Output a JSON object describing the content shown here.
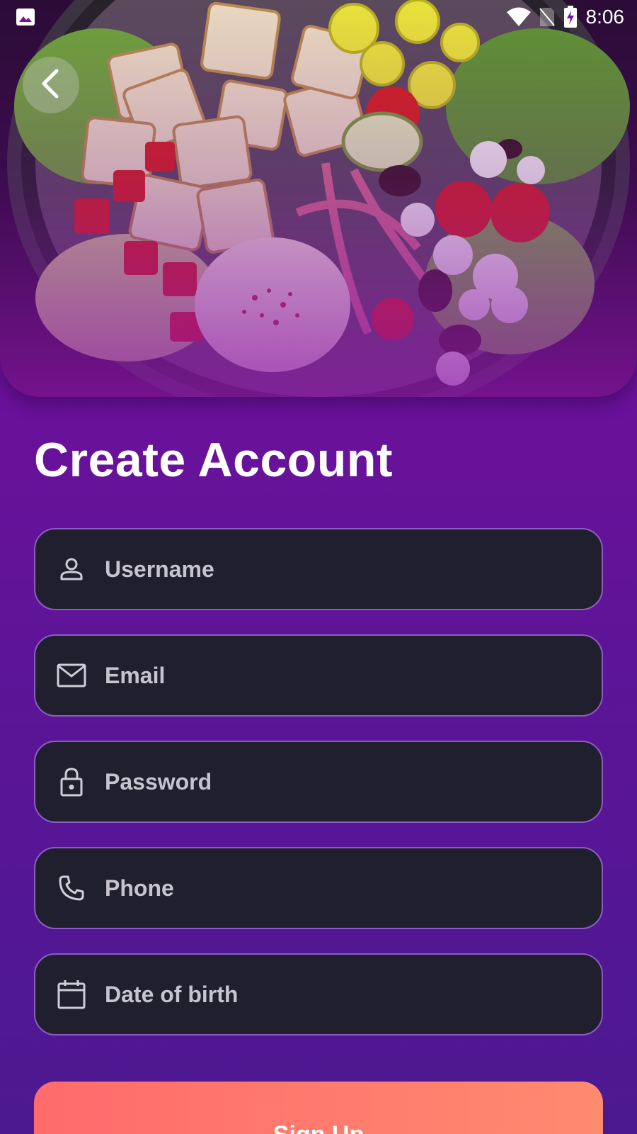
{
  "status_bar": {
    "time": "8:06",
    "icons": [
      "image-icon",
      "wifi-icon",
      "no-sim-icon",
      "battery-charging-icon"
    ]
  },
  "hero": {
    "image": "salad-bowl-photo",
    "back_icon": "chevron-left-icon"
  },
  "form": {
    "title": "Create Account",
    "fields": [
      {
        "name": "username",
        "placeholder": "Username",
        "icon": "person-icon"
      },
      {
        "name": "email",
        "placeholder": "Email",
        "icon": "mail-icon"
      },
      {
        "name": "password",
        "placeholder": "Password",
        "icon": "lock-icon"
      },
      {
        "name": "phone",
        "placeholder": "Phone",
        "icon": "phone-icon"
      },
      {
        "name": "dob",
        "placeholder": "Date of birth",
        "icon": "calendar-icon"
      }
    ],
    "submit_label": "Sign Up"
  },
  "colors": {
    "background_top": "#7a0fa0",
    "background_bottom": "#4c1990",
    "field_bg": "#1f1f2e",
    "field_border": "#8c5cc4",
    "button_start": "#ff6b6b",
    "button_end": "#ff8a70"
  }
}
